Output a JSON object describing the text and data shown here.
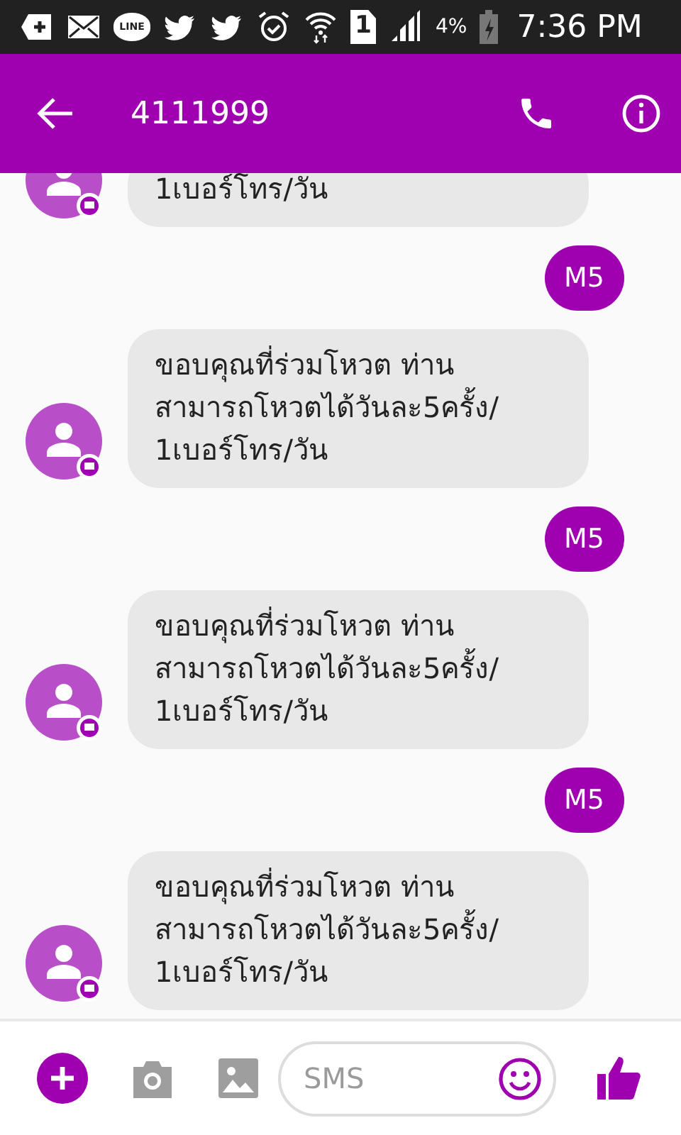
{
  "status_bar": {
    "line_label": "LINE",
    "sim": "1",
    "battery": "4%",
    "time": "7:36 PM"
  },
  "header": {
    "title": "4111999"
  },
  "messages": [
    {
      "kind": "incoming",
      "text": "1เบอร์โทร/วัน"
    },
    {
      "kind": "outgoing",
      "text": "M5"
    },
    {
      "kind": "incoming",
      "text": "ขอบคุณที่ร่วมโหวต ท่าน\nสามารถโหวตได้วันละ5ครั้ง/\n1เบอร์โทร/วัน"
    },
    {
      "kind": "outgoing",
      "text": "M5"
    },
    {
      "kind": "incoming",
      "text": "ขอบคุณที่ร่วมโหวต ท่าน\nสามารถโหวตได้วันละ5ครั้ง/\n1เบอร์โทร/วัน"
    },
    {
      "kind": "outgoing",
      "text": "M5"
    },
    {
      "kind": "incoming",
      "text": "ขอบคุณที่ร่วมโหวต ท่าน\nสามารถโหวตได้วันละ5ครั้ง/\n1เบอร์โทร/วัน"
    }
  ],
  "composer": {
    "placeholder": "SMS"
  }
}
